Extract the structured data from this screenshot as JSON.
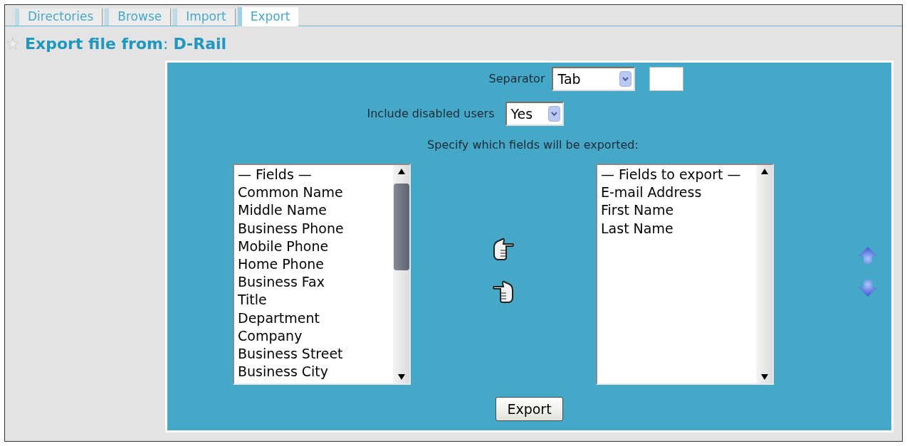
{
  "tabs": [
    {
      "label": "Directories",
      "selected": false
    },
    {
      "label": "Browse",
      "selected": false
    },
    {
      "label": "Import",
      "selected": false
    },
    {
      "label": "Export",
      "selected": true
    }
  ],
  "heading": "**Export file from**: **D-Rail**",
  "form": {
    "separator": {
      "label": "Separator",
      "value": "Tab"
    },
    "include_disabled": {
      "label": "Include disabled users",
      "value": "Yes"
    },
    "instruction": "Specify which fields will be exported:",
    "available_fields": {
      "header": "— Fields —",
      "items": [
        "Common Name",
        "Middle Name",
        "Business Phone",
        "Mobile Phone",
        "Home Phone",
        "Business Fax",
        "Title",
        "Department",
        "Company",
        "Business Street",
        "Business City"
      ]
    },
    "export_fields": {
      "header": "— Fields to export —",
      "items": [
        "E-mail Address",
        "First Name",
        "Last Name"
      ]
    },
    "submit": "Export"
  }
}
